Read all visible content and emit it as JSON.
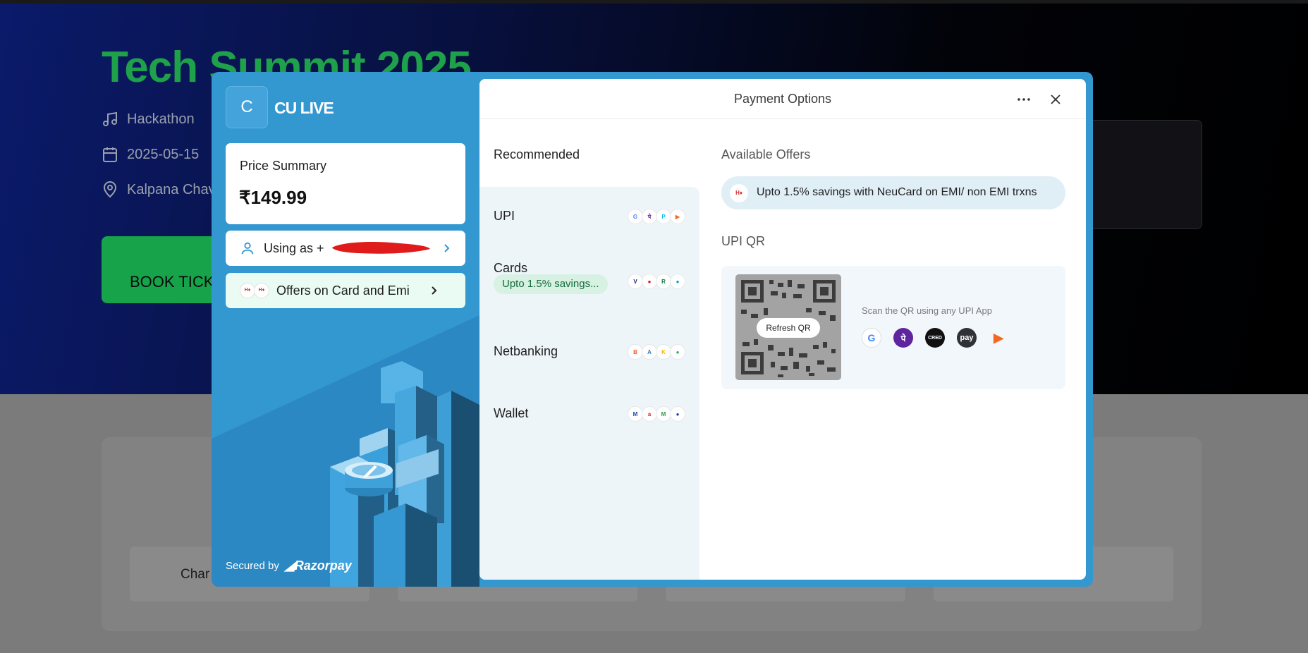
{
  "background_page": {
    "title": "Tech Summit 2025",
    "category": "Hackathon",
    "date": "2025-05-15",
    "venue_partial": "Kalpana Chav",
    "book_button_partial": "BOOK TICK",
    "lower_card_text_partial": "Char"
  },
  "brand": {
    "logo_letter": "C",
    "name": "CU LIVE",
    "accent_color": "#3397d0"
  },
  "price_summary": {
    "label": "Price Summary",
    "amount": "₹149.99"
  },
  "user_row": {
    "label": "Using as +"
  },
  "offers_row": {
    "label": "Offers on Card and Emi"
  },
  "footer": {
    "secured_by": "Secured by",
    "provider": "Razorpay"
  },
  "header": {
    "title": "Payment Options",
    "more_icon": "ellipsis-icon",
    "close_icon": "close-icon"
  },
  "methods": {
    "recommended_label": "Recommended",
    "items": [
      {
        "label": "UPI",
        "icons": [
          "google-pay-icon",
          "phonepe-icon",
          "paytm-icon",
          "bhim-icon"
        ]
      },
      {
        "label": "Cards",
        "badge": "Upto 1.5% savings...",
        "icons": [
          "visa-icon",
          "mastercard-icon",
          "rupay-icon",
          "maestro-icon"
        ]
      },
      {
        "label": "Netbanking",
        "icons": [
          "bank-icon",
          "bank-icon",
          "bank-icon",
          "bank-icon"
        ]
      },
      {
        "label": "Wallet",
        "icons": [
          "wallet-icon",
          "wallet-icon",
          "wallet-icon",
          "wallet-icon"
        ]
      }
    ]
  },
  "offers": {
    "label": "Available Offers",
    "items": [
      {
        "text": "Upto 1.5% savings with NeuCard on EMI/ non EMI trxns"
      }
    ]
  },
  "upi_qr": {
    "label": "UPI QR",
    "refresh_label": "Refresh QR",
    "scan_text": "Scan the QR using any UPI App",
    "apps": [
      "google-pay-icon",
      "phonepe-icon",
      "cred-icon",
      "amazon-pay-icon",
      "bhim-icon"
    ],
    "amazon_pay_text": "pay",
    "cred_text": "CRED"
  }
}
